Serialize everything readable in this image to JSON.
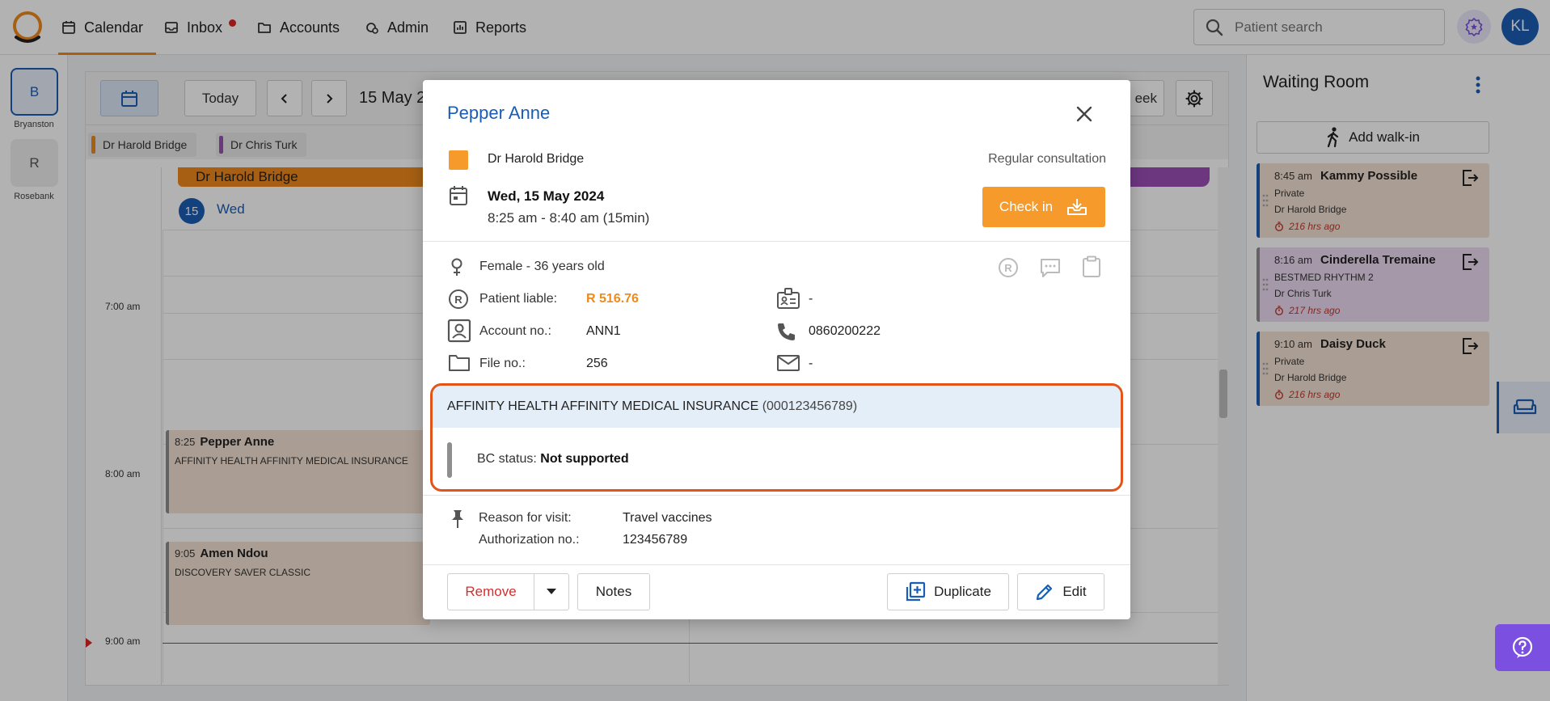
{
  "nav": {
    "items": [
      {
        "label": "Calendar",
        "icon": "calendar-icon"
      },
      {
        "label": "Inbox",
        "icon": "inbox-icon"
      },
      {
        "label": "Accounts",
        "icon": "folder-icon"
      },
      {
        "label": "Admin",
        "icon": "admin-icon"
      },
      {
        "label": "Reports",
        "icon": "reports-icon"
      }
    ],
    "search_placeholder": "Patient search",
    "avatar_initials": "KL",
    "accent": "#f08a1c",
    "brand": "#1a5db5"
  },
  "sites": [
    {
      "initial": "B",
      "label": "Bryanston"
    },
    {
      "initial": "R",
      "label": "Rosebank"
    }
  ],
  "calendar": {
    "today_label": "Today",
    "date_label": "15 May 2",
    "week_fragment": "eek",
    "doctors": [
      {
        "name": "Dr Harold Bridge",
        "color": "#f08a1c"
      },
      {
        "name": "Dr Chris Turk",
        "color": "#9c4fb8"
      }
    ],
    "column_doctor": "Dr Harold Bridge",
    "day_number": "15",
    "day_name": "Wed",
    "times": [
      "7:00 am",
      "8:00 am",
      "9:00 am"
    ],
    "appointments": [
      {
        "time": "8:25",
        "name": "Pepper Anne",
        "info": "AFFINITY HEALTH AFFINITY MEDICAL INSURANCE"
      },
      {
        "time": "9:05",
        "name": "Amen Ndou",
        "info": "DISCOVERY SAVER CLASSIC"
      }
    ]
  },
  "waiting_room": {
    "title": "Waiting Room",
    "add_walkin": "Add walk-in",
    "patients": [
      {
        "time": "8:45 am",
        "name": "Kammy Possible",
        "plan": "Private",
        "doctor": "Dr Harold Bridge",
        "ago": "216 hrs ago",
        "color": "#1a5db5",
        "bg": "#f4e2d4"
      },
      {
        "time": "8:16 am",
        "name": "Cinderella Tremaine",
        "plan": "BESTMED RHYTHM 2",
        "doctor": "Dr Chris Turk",
        "ago": "217 hrs ago",
        "color": "#8e8e8e",
        "bg": "#ecdcf2"
      },
      {
        "time": "9:10 am",
        "name": "Daisy Duck",
        "plan": "Private",
        "doctor": "Dr Harold Bridge",
        "ago": "216 hrs ago",
        "color": "#1a5db5",
        "bg": "#f4e2d4"
      }
    ]
  },
  "modal": {
    "patient_name": "Pepper Anne",
    "doctor": "Dr Harold Bridge",
    "appointment_type": "Regular consultation",
    "date": "Wed, 15 May 2024",
    "time_range": "8:25 am - 8:40 am (15min)",
    "checkin_label": "Check in",
    "gender_age": "Female -  36 years old",
    "patient_liable_label": "Patient liable:",
    "patient_liable_value": "R 516.76",
    "account_label": "Account no.:",
    "account_value": "ANN1",
    "file_label": "File no.:",
    "file_value": "256",
    "id_value": "-",
    "phone_value": "0860200222",
    "email_value": "-",
    "insurance_name": "AFFINITY HEALTH AFFINITY MEDICAL INSURANCE",
    "insurance_code": "(000123456789)",
    "bc_status_label": "BC status:",
    "bc_status_value": "Not supported",
    "reason_label": "Reason for visit:",
    "reason_value": "Travel vaccines",
    "auth_label": "Authorization no.:",
    "auth_value": "123456789",
    "remove_label": "Remove",
    "notes_label": "Notes",
    "duplicate_label": "Duplicate",
    "edit_label": "Edit"
  }
}
